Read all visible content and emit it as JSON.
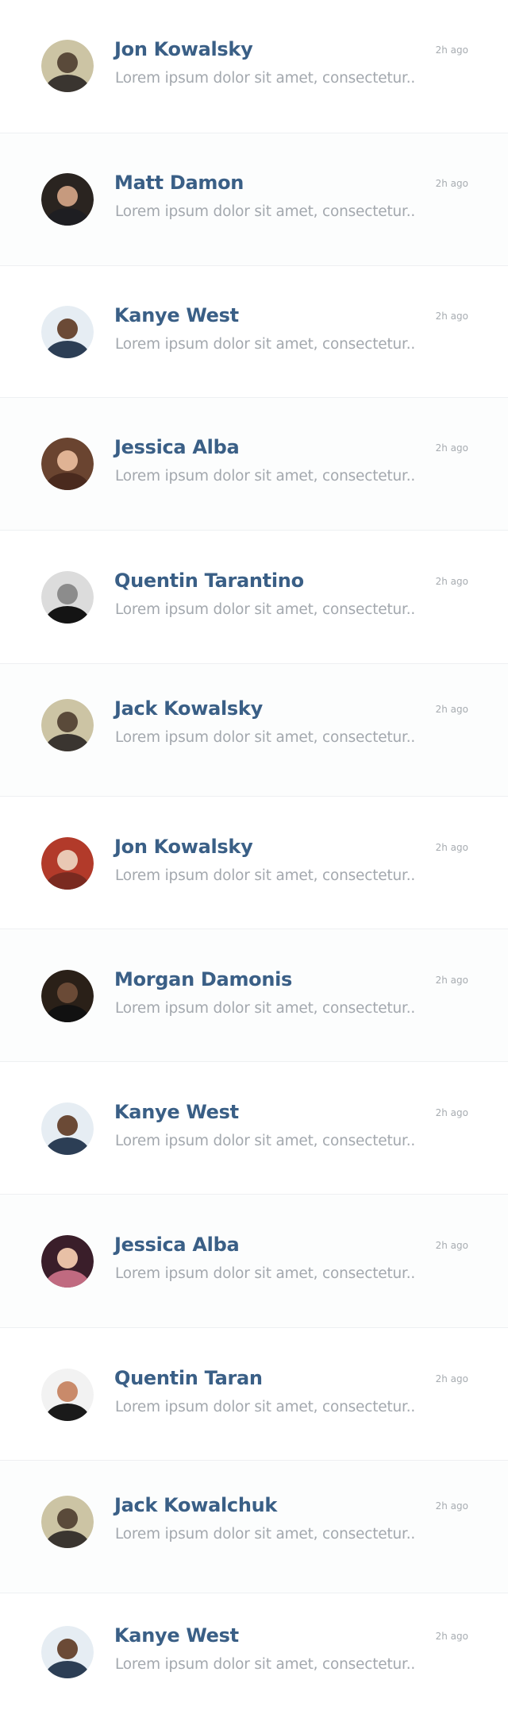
{
  "conversations": [
    {
      "name": "Jon Kowalsky",
      "preview": "Lorem ipsum dolor sit amet, consectetur..",
      "time": "2h ago",
      "avatar": "avatar-hooded",
      "avatar_bg": "#ccc4a4",
      "avatar_skin": "#5a4a3a",
      "avatar_cloth": "#3a3530"
    },
    {
      "name": "Matt Damon",
      "preview": "Lorem ipsum dolor sit amet, consectetur..",
      "time": "2h ago",
      "avatar": "avatar-portrait",
      "avatar_bg": "#2a2420",
      "avatar_skin": "#c69a7e",
      "avatar_cloth": "#1e1e22"
    },
    {
      "name": "Kanye West",
      "preview": "Lorem ipsum dolor sit amet, consectetur..",
      "time": "2h ago",
      "avatar": "avatar-portrait",
      "avatar_bg": "#e6edf3",
      "avatar_skin": "#6b4a36",
      "avatar_cloth": "#2c3e55"
    },
    {
      "name": "Jessica Alba",
      "preview": "Lorem ipsum dolor sit amet, consectetur..",
      "time": "2h ago",
      "avatar": "avatar-portrait",
      "avatar_bg": "#6a4430",
      "avatar_skin": "#e0b394",
      "avatar_cloth": "#4a2a1e"
    },
    {
      "name": "Quentin Tarantino",
      "preview": "Lorem ipsum dolor sit amet, consectetur..",
      "time": "2h ago",
      "avatar": "avatar-portrait",
      "avatar_bg": "#dcdcdc",
      "avatar_skin": "#8c8c8c",
      "avatar_cloth": "#141414"
    },
    {
      "name": "Jack Kowalsky",
      "preview": "Lorem ipsum dolor sit amet, consectetur..",
      "time": "2h ago",
      "avatar": "avatar-hooded",
      "avatar_bg": "#ccc4a4",
      "avatar_skin": "#5a4a3a",
      "avatar_cloth": "#3a3530"
    },
    {
      "name": "Jon Kowalsky",
      "preview": "Lorem ipsum dolor sit amet, consectetur..",
      "time": "2h ago",
      "avatar": "avatar-portrait",
      "avatar_bg": "#b23a2a",
      "avatar_skin": "#e9c8b4",
      "avatar_cloth": "#7a2a20"
    },
    {
      "name": "Morgan Damonis",
      "preview": "Lorem ipsum dolor sit amet, consectetur..",
      "time": "2h ago",
      "avatar": "avatar-portrait",
      "avatar_bg": "#2a2018",
      "avatar_skin": "#6a4a36",
      "avatar_cloth": "#111111"
    },
    {
      "name": "Kanye West",
      "preview": "Lorem ipsum dolor sit amet, consectetur..",
      "time": "2h ago",
      "avatar": "avatar-portrait",
      "avatar_bg": "#e6edf3",
      "avatar_skin": "#6b4a36",
      "avatar_cloth": "#2c3e55"
    },
    {
      "name": "Jessica Alba",
      "preview": "Lorem ipsum dolor sit amet, consectetur..",
      "time": "2h ago",
      "avatar": "avatar-portrait",
      "avatar_bg": "#3a1e2a",
      "avatar_skin": "#e8c0a6",
      "avatar_cloth": "#c06a80"
    },
    {
      "name": "Quentin Taran",
      "preview": "Lorem ipsum dolor sit amet, consectetur..",
      "time": "2h ago",
      "avatar": "avatar-portrait",
      "avatar_bg": "#f2f2f2",
      "avatar_skin": "#c98a6a",
      "avatar_cloth": "#1a1a1a"
    },
    {
      "name": "Jack Kowalchuk",
      "preview": "Lorem ipsum dolor sit amet, consectetur..",
      "time": "2h ago",
      "avatar": "avatar-hooded",
      "avatar_bg": "#ccc4a4",
      "avatar_skin": "#5a4a3a",
      "avatar_cloth": "#3a3530"
    },
    {
      "name": "Kanye West",
      "preview": "Lorem ipsum dolor sit amet, consectetur..",
      "time": "2h ago",
      "avatar": "avatar-portrait",
      "avatar_bg": "#e6edf3",
      "avatar_skin": "#6b4a36",
      "avatar_cloth": "#2c3e55"
    }
  ]
}
